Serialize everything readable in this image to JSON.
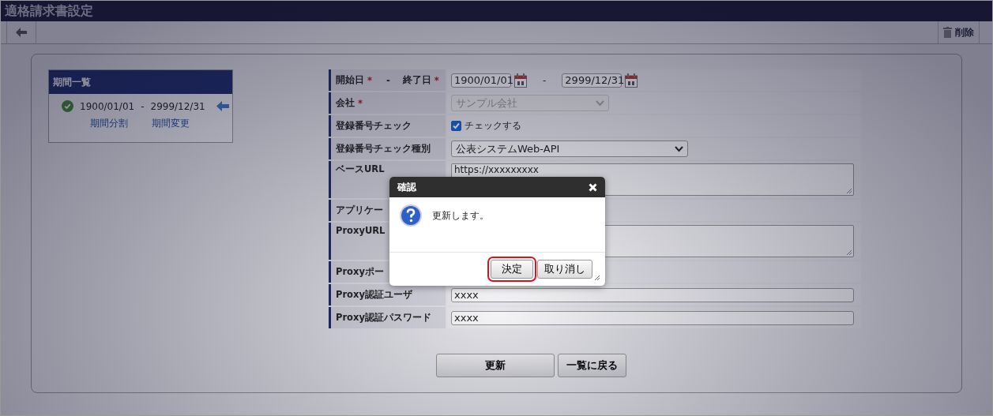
{
  "window": {
    "title": "適格請求書設定"
  },
  "toolbar": {
    "delete_label": "削除"
  },
  "period_list": {
    "title": "期間一覧",
    "items": [
      {
        "start": "1900/01/01",
        "separator": "-",
        "end": "2999/12/31",
        "valid": true,
        "selected": true
      }
    ],
    "links": [
      "期間分割",
      "期間変更"
    ]
  },
  "fields": [
    {
      "kind": "date-range",
      "label": "開始日",
      "required_mark": "*",
      "label_separator": "-",
      "label_end": "終了日",
      "required_mark_end": "*",
      "start": "1900/01/01",
      "value_separator": "-",
      "end": "2999/12/31"
    },
    {
      "kind": "select",
      "label": "会社",
      "required_mark": "*",
      "value": "サンプル会社",
      "disabled": true
    },
    {
      "kind": "checkbox",
      "label": "登録番号チェック",
      "checked": true,
      "text": "チェックする"
    },
    {
      "kind": "select",
      "label": "登録番号チェック種別",
      "value": "公表システムWeb-API",
      "disabled": false
    },
    {
      "kind": "textarea",
      "label": "ベースURL",
      "value": "https://xxxxxxxxx"
    },
    {
      "kind": "blank",
      "label": "アプリケー"
    },
    {
      "kind": "textarea",
      "label": "ProxyURL"
    },
    {
      "kind": "blank",
      "label": "Proxyポー"
    },
    {
      "kind": "text",
      "label": "Proxy認証ユーザ",
      "value": "xxxx"
    },
    {
      "kind": "text",
      "label": "Proxy認証パスワード",
      "value": "xxxx"
    }
  ],
  "actions": [
    "更新",
    "一覧に戻る"
  ],
  "dialog": {
    "title": "確認",
    "message": "更新します。",
    "buttons": [
      {
        "label": "決定",
        "focused": true
      },
      {
        "label": "取り消し",
        "focused": false
      }
    ]
  }
}
